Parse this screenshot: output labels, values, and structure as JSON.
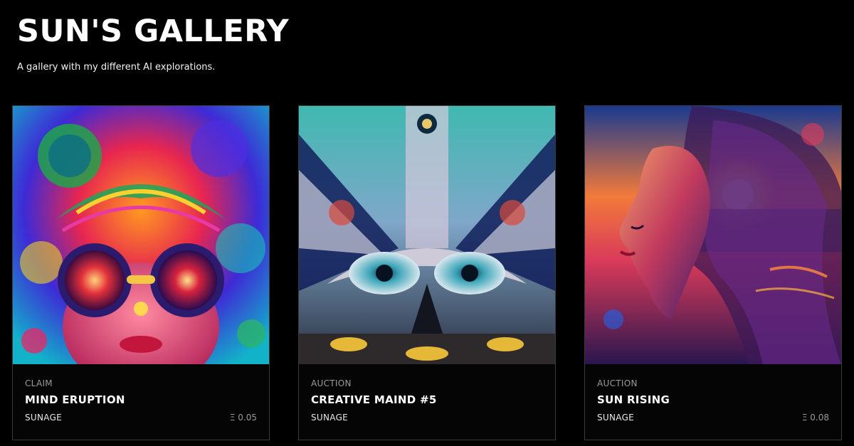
{
  "gallery": {
    "title": "SUN'S GALLERY",
    "subtitle": "A gallery with my different AI explorations."
  },
  "cards": [
    {
      "type": "CLAIM",
      "title": "MIND ERUPTION",
      "artist": "SUNAGE",
      "price": "Ξ 0.05",
      "artwork": "psychedelic-face-with-goggles"
    },
    {
      "type": "AUCTION",
      "title": "CREATIVE MAIND #5",
      "artist": "SUNAGE",
      "price": "",
      "artwork": "symmetric-mask-with-eyes"
    },
    {
      "type": "AUCTION",
      "title": "SUN RISING",
      "artist": "SUNAGE",
      "price": "Ξ 0.08",
      "artwork": "woman-profile-with-sunset"
    }
  ],
  "colors": {
    "background": "#000000",
    "card_border": "#3a3a3a",
    "muted_text": "#9a9a9a"
  }
}
